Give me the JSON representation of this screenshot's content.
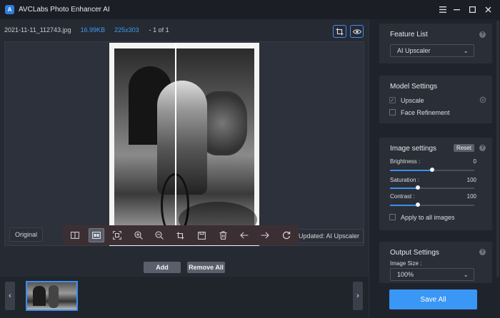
{
  "window": {
    "title": "AVCLabs Photo Enhancer AI",
    "logo_text": "A"
  },
  "file_info": {
    "name": "2021-11-11_112743.jpg",
    "size": "16.99KB",
    "dimensions": "225x303",
    "page": "- 1 of 1"
  },
  "preview": {
    "original_label": "Original",
    "updated_label": "Updated: AI Upscaler",
    "split_position": 0.44
  },
  "actions": {
    "add": "Add",
    "remove_all": "Remove All"
  },
  "feature_list": {
    "title": "Feature List",
    "selected": "AI Upscaler"
  },
  "model_settings": {
    "title": "Model Settings",
    "upscale": "Upscale",
    "face_refinement": "Face Refinement",
    "upscale_checked": true,
    "face_refinement_checked": false
  },
  "image_settings": {
    "title": "Image settings",
    "reset": "Reset",
    "brightness": {
      "label": "Brightness :",
      "value": "0",
      "fraction": 0.5
    },
    "saturation": {
      "label": "Saturation :",
      "value": "100",
      "fraction": 0.33
    },
    "contrast": {
      "label": "Contrast :",
      "value": "100",
      "fraction": 0.33
    },
    "apply_all": "Apply to all images"
  },
  "output_settings": {
    "title": "Output Settings",
    "image_size_label": "Image Size :",
    "image_size": "100%"
  },
  "save_all": "Save All",
  "colors": {
    "accent": "#3b8ff0",
    "save_button": "#3a97f5",
    "toolbar_bg": "#3c2f33"
  }
}
